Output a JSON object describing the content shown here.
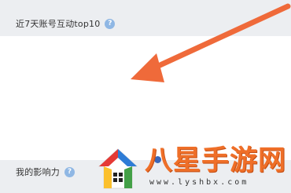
{
  "sections": {
    "top": {
      "title": "近7天账号互动top10",
      "help_icon": "question-mark-icon"
    },
    "bottom": {
      "title": "我的影响力",
      "help_icon": "question-mark-icon"
    }
  },
  "help_glyph": "?",
  "annotation": {
    "type": "arrow",
    "icon": "orange-arrow-icon",
    "color": "#ef6a3a"
  },
  "watermark": {
    "text": "八星手游网",
    "url": "www.lyshbx.com",
    "logo": "colorful-house-logo",
    "color": "#ef6f28"
  },
  "colors": {
    "band_background": "#eceef1",
    "help_icon": "#8fb7e4",
    "dot": "#3a67b8"
  }
}
